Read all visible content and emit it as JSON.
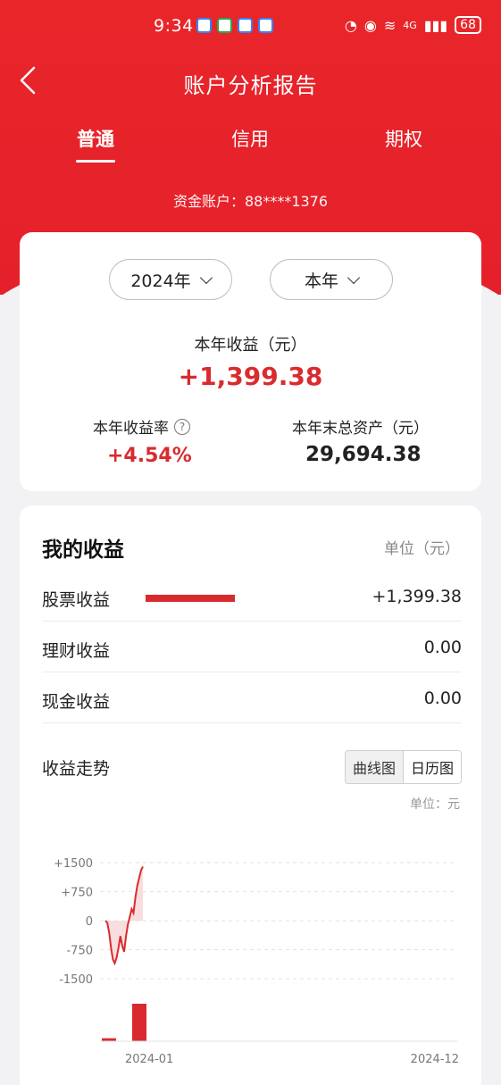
{
  "status_bar": {
    "time": "9:34",
    "network": "4G",
    "battery": "68"
  },
  "header": {
    "title": "账户分析报告",
    "back_icon": "chevron-left-icon"
  },
  "tabs": [
    {
      "label": "普通",
      "active": true
    },
    {
      "label": "信用",
      "active": false
    },
    {
      "label": "期权",
      "active": false
    }
  ],
  "account": {
    "label": "资金账户：88****1376"
  },
  "summary": {
    "year_select": "2024年",
    "period_select": "本年",
    "income_label": "本年收益（元）",
    "income_value": "+1,399.38",
    "rate_label": "本年收益率",
    "rate_value": "+4.54%",
    "assets_label": "本年末总资产（元）",
    "assets_value": "29,694.38"
  },
  "earnings": {
    "title": "我的收益",
    "unit": "单位（元）",
    "rows": [
      {
        "label": "股票收益",
        "value": "+1,399.38",
        "bar_fraction": 1.0
      },
      {
        "label": "理财收益",
        "value": "0.00",
        "bar_fraction": 0
      },
      {
        "label": "现金收益",
        "value": "0.00",
        "bar_fraction": 0
      }
    ]
  },
  "trend": {
    "title": "收益走势",
    "toggle_curve": "曲线图",
    "toggle_calendar": "日历图",
    "unit": "单位：元"
  },
  "chart_data": {
    "type": "line",
    "y_ticks": [
      "+1500",
      "+750",
      "0",
      "-750",
      "-1500"
    ],
    "y_values": [
      1500,
      750,
      0,
      -750,
      -1500
    ],
    "x_labels": [
      "2024-01",
      "2024-12"
    ],
    "ylim": [
      -1500,
      1500
    ],
    "series": [
      {
        "values": [
          0,
          -50,
          -300,
          -700,
          -1000,
          -1100,
          -950,
          -700,
          -400,
          -650,
          -800,
          -400,
          -100,
          100,
          300,
          200,
          600,
          900,
          1100,
          1300,
          1399
        ]
      }
    ],
    "bars": [
      80,
      1000
    ],
    "colors": {
      "line": "#d92b2f",
      "fill": "#f7d6d7"
    }
  }
}
